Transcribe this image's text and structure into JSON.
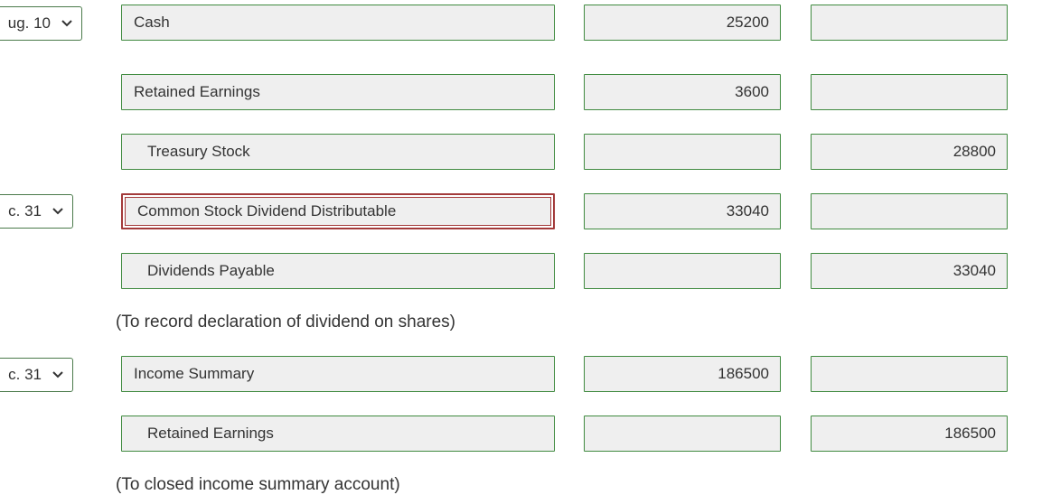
{
  "entries": [
    {
      "date": "ug. 10",
      "lines": [
        {
          "account": "Cash",
          "debit": "25200",
          "credit": ""
        },
        {
          "account": "Retained Earnings",
          "debit": "3600",
          "credit": ""
        },
        {
          "account": "Treasury Stock",
          "debit": "",
          "credit": "28800"
        }
      ]
    },
    {
      "date": "c. 31",
      "lines": [
        {
          "account": "Common Stock Dividend Distributable",
          "debit": "33040",
          "credit": ""
        },
        {
          "account": "Dividends Payable",
          "debit": "",
          "credit": "33040"
        }
      ],
      "memo": "(To record declaration of dividend on shares)"
    },
    {
      "date": "c. 31",
      "lines": [
        {
          "account": "Income Summary",
          "debit": "186500",
          "credit": ""
        },
        {
          "account": "Retained Earnings",
          "debit": "",
          "credit": "186500"
        }
      ],
      "memo": "(To closed income summary account)"
    }
  ],
  "icons": {
    "select_arrow": "chevron-down-icon"
  },
  "colors": {
    "field_border": "#3f8a3f",
    "active_border": "#a33a3a",
    "field_background": "#efefef"
  }
}
